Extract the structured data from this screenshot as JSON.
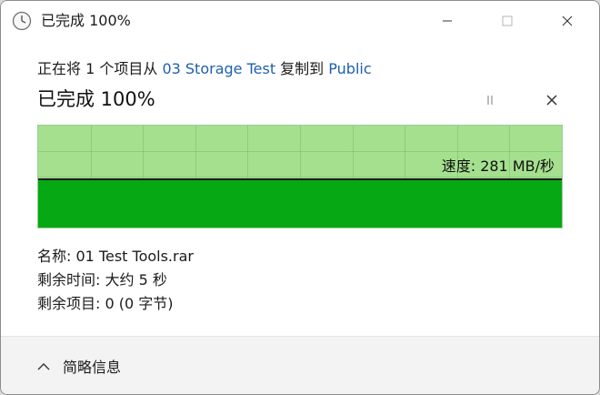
{
  "window": {
    "title": "已完成 100%",
    "icon": "clock-icon"
  },
  "titlebar_buttons": {
    "minimize": "minimize-icon",
    "maximize": "maximize-icon",
    "close": "close-icon"
  },
  "copy": {
    "prefix": "正在将 1 个项目从 ",
    "source": "03 Storage Test",
    "middle": " 复制到 ",
    "destination": "Public"
  },
  "status": {
    "label": "已完成 100%",
    "percent": 100
  },
  "controls": {
    "pause": "pause-icon",
    "cancel": "close-icon"
  },
  "graph": {
    "speed_label": "速度: 281 MB/秒",
    "fill_fraction": 0.48,
    "colors": {
      "background": "#a5e08f",
      "fill": "#06a814",
      "line": "#1a1a1a"
    }
  },
  "details": {
    "name": "名称: 01 Test Tools.rar",
    "time_remaining": "剩余时间: 大约 5 秒",
    "items_remaining": "剩余项目: 0 (0 字节)"
  },
  "footer": {
    "toggle_label": "简略信息",
    "toggle_icon": "chevron-up-icon"
  }
}
